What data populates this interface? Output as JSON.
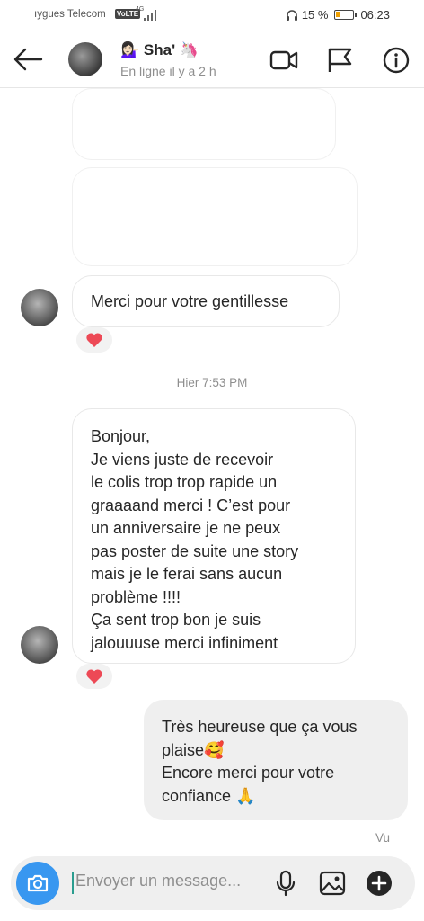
{
  "status_bar": {
    "carrier": "ıygues Telecom",
    "volte": "VoLTE",
    "network": "4G",
    "battery_text": "15 %",
    "battery_level": 0.15,
    "time": "06:23"
  },
  "header": {
    "name": "💁🏻‍♀️ Sha' 🦄",
    "presence": "En ligne il y a 2 h"
  },
  "messages": {
    "msg1": "Merci pour votre gentillesse",
    "timestamp": "Hier 7:53 PM",
    "msg2_lines": [
      "Bonjour,",
      "Je viens juste de recevoir",
      "le colis trop trop rapide un",
      "graaaand merci ! C’est pour",
      "un anniversaire je ne peux",
      "pas poster de suite une story",
      "mais je le ferai sans aucun",
      "problème !!!!",
      "Ça sent trop bon je suis",
      "jalouuuse merci infiniment"
    ],
    "reply_lines": [
      "Très heureuse que ça vous",
      "plaise🥰",
      "Encore merci pour votre",
      "confiance 🙏"
    ],
    "seen": "Vu"
  },
  "composer": {
    "placeholder": "Envoyer un message..."
  },
  "colors": {
    "accent": "#3897f0",
    "heart": "#ed4956",
    "muted_text": "#8e8e8e",
    "outgoing_bubble": "#efefef"
  }
}
